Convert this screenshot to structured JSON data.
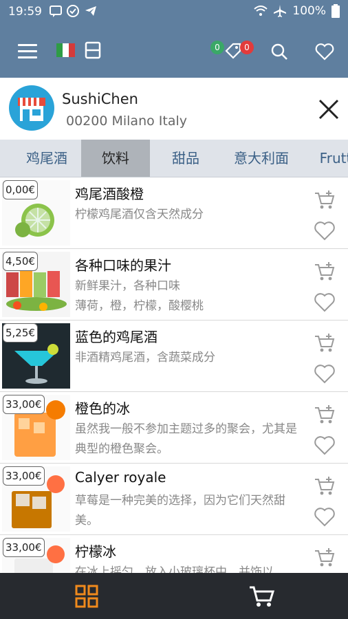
{
  "status_bar": {
    "time": "19:59",
    "battery": "100%"
  },
  "app_bar": {
    "badge_green": "0",
    "badge_red": "0",
    "accent_green": "#3aa867",
    "accent_red": "#e23b3b"
  },
  "shop": {
    "name": "SushiChen",
    "address": "00200 Milano Italy"
  },
  "tabs": [
    {
      "label": "鸡尾酒"
    },
    {
      "label": "饮料"
    },
    {
      "label": "甜品"
    },
    {
      "label": "意大利面"
    },
    {
      "label": "Frutt"
    }
  ],
  "items": [
    {
      "price": "0,00€",
      "name": "鸡尾酒酸橙",
      "desc": "柠檬鸡尾酒仅含天然成分"
    },
    {
      "price": "4,50€",
      "name": "各种口味的果汁",
      "desc": "新鲜果汁，各种口味\n薄荷，橙，柠檬，酸樱桃"
    },
    {
      "price": "5,25€",
      "name": "蓝色的鸡尾酒",
      "desc": "非酒精鸡尾酒，含蔬菜成分"
    },
    {
      "price": "33,00€",
      "name": "橙色的冰",
      "desc": "虽然我一般不参加主题过多的聚会，尤其是典型的橙色聚会。"
    },
    {
      "price": "33,00€",
      "name": "Calyer royale",
      "desc": "草莓是一种完美的选择，因为它们天然甜美。"
    },
    {
      "price": "33,00€",
      "name": "柠檬冰",
      "desc": "在冰上摇匀，放入小玻璃杯中，并饰以"
    }
  ],
  "colors": {
    "primary": "#5f7f9f",
    "bottom_bar": "#272a2f",
    "orange": "#f08a1c"
  }
}
